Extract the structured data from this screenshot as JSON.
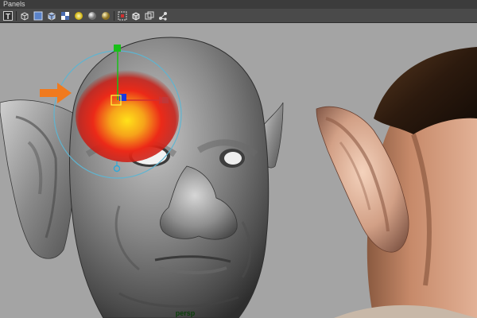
{
  "menubar": {
    "panels_label": "Panels"
  },
  "toolbar": {
    "icons": [
      "text-icon",
      "wireframe-cube-icon",
      "shaded-cube-icon",
      "textured-cube-icon",
      "light-bulb-icon",
      "gray-sphere-icon",
      "shadow-sphere-icon",
      "select-camera-icon",
      "isolate-cube-icon",
      "xray-cube-icon",
      "nodes-icon"
    ]
  },
  "viewport": {
    "camera_label": "persp",
    "left_model": "gray-sculpt-head",
    "right_model": "rendered-skin-head-with-elf-ear",
    "brush_color": "#e8201a",
    "arrow_color": "#f07a1e",
    "manipulator_colors": {
      "x": "#d03030",
      "y": "#18c018",
      "z": "#1838e0",
      "rotate_ring": "#5fb4d0"
    }
  }
}
